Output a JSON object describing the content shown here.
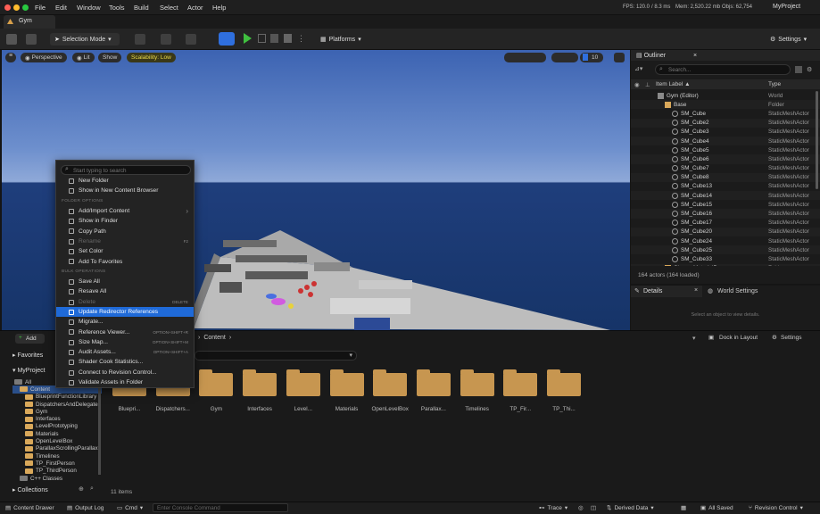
{
  "app": {
    "project": "MyProject",
    "doc_tab": "Gym"
  },
  "menubar": {
    "items": [
      "File",
      "Edit",
      "Window",
      "Tools",
      "Build",
      "Select",
      "Actor",
      "Help"
    ]
  },
  "stats": {
    "fps": "FPS: 120.0",
    "ms": "/ 8.3 ms",
    "mem": "Mem: 2,520.22 mb",
    "objs": "Objs: 62,754"
  },
  "toolbar": {
    "selection_mode": "Selection Mode",
    "platforms": "Platforms",
    "settings": "Settings"
  },
  "viewport": {
    "perspective": "Perspective",
    "lit": "Lit",
    "show": "Show",
    "scalability": "Scalability: Low",
    "grid_value": "10"
  },
  "outliner": {
    "title": "Outliner",
    "search_placeholder": "Search...",
    "col_label": "Item Label ▲",
    "col_type": "Type",
    "rows": [
      {
        "label": "Gym (Editor)",
        "type": "World",
        "indent": 0
      },
      {
        "label": "Base",
        "type": "Folder",
        "indent": 1
      },
      {
        "label": "SM_Cube",
        "type": "StaticMeshActor",
        "indent": 2
      },
      {
        "label": "SM_Cube2",
        "type": "StaticMeshActor",
        "indent": 2
      },
      {
        "label": "SM_Cube3",
        "type": "StaticMeshActor",
        "indent": 2
      },
      {
        "label": "SM_Cube4",
        "type": "StaticMeshActor",
        "indent": 2
      },
      {
        "label": "SM_Cube5",
        "type": "StaticMeshActor",
        "indent": 2
      },
      {
        "label": "SM_Cube6",
        "type": "StaticMeshActor",
        "indent": 2
      },
      {
        "label": "SM_Cube7",
        "type": "StaticMeshActor",
        "indent": 2
      },
      {
        "label": "SM_Cube8",
        "type": "StaticMeshActor",
        "indent": 2
      },
      {
        "label": "SM_Cube13",
        "type": "StaticMeshActor",
        "indent": 2
      },
      {
        "label": "SM_Cube14",
        "type": "StaticMeshActor",
        "indent": 2
      },
      {
        "label": "SM_Cube15",
        "type": "StaticMeshActor",
        "indent": 2
      },
      {
        "label": "SM_Cube16",
        "type": "StaticMeshActor",
        "indent": 2
      },
      {
        "label": "SM_Cube17",
        "type": "StaticMeshActor",
        "indent": 2
      },
      {
        "label": "SM_Cube20",
        "type": "StaticMeshActor",
        "indent": 2
      },
      {
        "label": "SM_Cube24",
        "type": "StaticMeshActor",
        "indent": 2
      },
      {
        "label": "SM_Cube25",
        "type": "StaticMeshActor",
        "indent": 2
      },
      {
        "label": "SM_Cube33",
        "type": "StaticMeshActor",
        "indent": 2
      },
      {
        "label": "ChangeMaterialParam",
        "type": "Folder",
        "indent": 1
      }
    ],
    "footer": "164 actors (164 loaded)"
  },
  "details": {
    "tab": "Details",
    "world_settings": "World Settings",
    "empty": "Select an object to view details."
  },
  "content_browser": {
    "add": "Add",
    "breadcrumb": "Content",
    "dock": "Dock in Layout",
    "settings": "Settings",
    "favorites": "Favorites",
    "project": "MyProject",
    "tree": [
      "All",
      "Content",
      "BlueprintFunctionLibrary",
      "DispatchersAndDelegates",
      "Gym",
      "Interfaces",
      "LevelPrototyping",
      "Materials",
      "OpenLevelBox",
      "ParallaxScrollingParallax",
      "Timelines",
      "TP_FirstPerson",
      "TP_ThirdPerson",
      "C++ Classes"
    ],
    "folders": [
      "Bluepri...",
      "Dispatchers...",
      "Gym",
      "Interfaces",
      "Level...",
      "Materials",
      "OpenLevelBox",
      "Parallax...",
      "Timelines",
      "TP_Fir...",
      "TP_Thi..."
    ],
    "collections": "Collections",
    "count": "11 items"
  },
  "context_menu": {
    "search_placeholder": "Start typing to search",
    "items": [
      {
        "label": "New Folder",
        "kind": "item"
      },
      {
        "label": "Show in New Content Browser",
        "kind": "item"
      },
      {
        "label": "FOLDER OPTIONS",
        "kind": "section"
      },
      {
        "label": "Add/Import Content",
        "kind": "item",
        "submenu": true
      },
      {
        "label": "Show in Finder",
        "kind": "item"
      },
      {
        "label": "Copy Path",
        "kind": "item"
      },
      {
        "label": "Rename",
        "kind": "disabled",
        "shortcut": "F2"
      },
      {
        "label": "Set Color",
        "kind": "item"
      },
      {
        "label": "Add To Favorites",
        "kind": "item"
      },
      {
        "label": "BULK OPERATIONS",
        "kind": "section"
      },
      {
        "label": "Save All",
        "kind": "item"
      },
      {
        "label": "Resave All",
        "kind": "item"
      },
      {
        "label": "Delete",
        "kind": "disabled",
        "shortcut": "DELETE"
      },
      {
        "label": "Update Redirector References",
        "kind": "highlight"
      },
      {
        "label": "Migrate...",
        "kind": "item"
      },
      {
        "label": "Reference Viewer...",
        "kind": "item",
        "shortcut": "OPTION+SHIFT+R"
      },
      {
        "label": "Size Map...",
        "kind": "item",
        "shortcut": "OPTION+SHIFT+M"
      },
      {
        "label": "Audit Assets...",
        "kind": "item",
        "shortcut": "OPTION+SHIFT+A"
      },
      {
        "label": "Shader Cook Statistics...",
        "kind": "item"
      },
      {
        "label": "Connect to Revision Control...",
        "kind": "item"
      },
      {
        "label": "Validate Assets in Folder",
        "kind": "item"
      }
    ]
  },
  "statusbar": {
    "content_drawer": "Content Drawer",
    "output_log": "Output Log",
    "cmd": "Cmd",
    "console_placeholder": "Enter Console Command",
    "trace": "Trace",
    "derived_data": "Derived Data",
    "all_saved": "All Saved",
    "revision_control": "Revision Control"
  },
  "colors": {
    "accent": "#1f6ad8",
    "play": "#3fbf3f",
    "folder": "#c79650"
  }
}
